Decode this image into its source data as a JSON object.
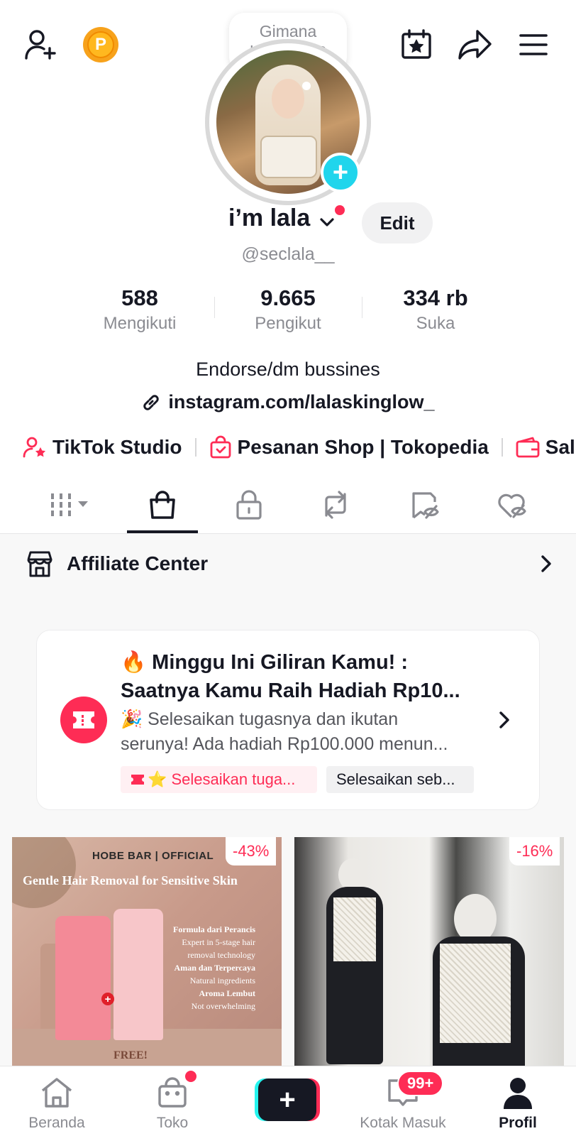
{
  "header": {
    "add_friend_icon": "person-plus-icon",
    "coin_label": "P",
    "calendar_icon": "calendar-star-icon",
    "share_icon": "share-arrow-icon",
    "menu_icon": "hamburger-menu-icon"
  },
  "profile": {
    "status_bubble": [
      "Gimana",
      "kabarnya?"
    ],
    "display_name": "i’m lala",
    "edit_label": "Edit",
    "handle": "@seclala__",
    "stats": [
      {
        "value": "588",
        "label": "Mengikuti"
      },
      {
        "value": "9.665",
        "label": "Pengikut"
      },
      {
        "value": "334 rb",
        "label": "Suka"
      }
    ],
    "bio": "Endorse/dm bussines",
    "link": "instagram.com/lalaskinglow_"
  },
  "shortcuts": [
    {
      "label": "TikTok Studio",
      "icon": "studio-person-icon"
    },
    {
      "label": "Pesanan Shop | Tokopedia",
      "icon": "shop-bag-icon"
    },
    {
      "label": "Sal",
      "icon": "wallet-icon"
    }
  ],
  "tabs": [
    {
      "name": "grid-tab",
      "icon": "grid-icon"
    },
    {
      "name": "shop-tab",
      "icon": "shopping-bag-icon",
      "active": true
    },
    {
      "name": "private-tab",
      "icon": "lock-icon"
    },
    {
      "name": "repost-tab",
      "icon": "repost-icon"
    },
    {
      "name": "favorites-tab",
      "icon": "bookmark-hidden-icon"
    },
    {
      "name": "liked-tab",
      "icon": "heart-hidden-icon"
    }
  ],
  "affiliate": {
    "label": "Affiliate Center"
  },
  "promo": {
    "title_line1": "🔥 Minggu Ini Giliran Kamu! :",
    "title_line2": "Saatnya Kamu Raih Hadiah Rp10...",
    "desc_line1": "🎉 Selesaikan tugasnya dan ikutan",
    "desc_line2": "serunya! Ada hadiah Rp100.000 menun...",
    "chip_primary": "⭐ Selesaikan tuga...",
    "chip_secondary": "Selesaikan seb..."
  },
  "products": [
    {
      "discount": "-43%",
      "brand": "HOBE BAR | OFFICIAL",
      "headline": "Gentle Hair Removal for Sensitive Skin",
      "lines": [
        "Formula dari Perancis",
        "Expert in 5-stage hair",
        "removal technology",
        "Aman dan Terpercaya",
        "Natural ingredients",
        "Aroma Lembut",
        "Not overwhelming"
      ],
      "free": "FREE!"
    },
    {
      "discount": "-16%"
    }
  ],
  "bottom_nav": {
    "items": [
      {
        "label": "Beranda",
        "icon": "home-icon"
      },
      {
        "label": "Toko",
        "icon": "shop-icon"
      },
      {
        "label": "",
        "icon": "create-plus-icon"
      },
      {
        "label": "Kotak Masuk",
        "icon": "inbox-icon"
      },
      {
        "label": "Profil",
        "icon": "profile-icon"
      }
    ],
    "inbox_badge": "99+"
  },
  "colors": {
    "accent": "#fe2c55",
    "cyan": "#20d5ec",
    "text": "#161823",
    "muted": "#8a8b91"
  }
}
